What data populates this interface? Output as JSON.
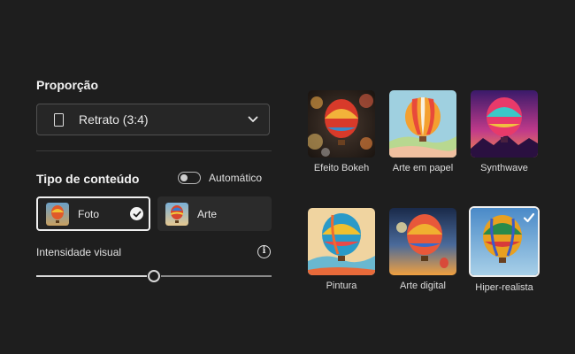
{
  "aspect": {
    "heading": "Proporção",
    "selected": "Retrato (3:4)",
    "icon": "portrait-icon"
  },
  "content_type": {
    "heading": "Tipo de conteúdo",
    "auto_label": "Automático",
    "auto_enabled": false,
    "options": [
      {
        "label": "Foto",
        "selected": true
      },
      {
        "label": "Arte",
        "selected": false
      }
    ]
  },
  "visual_intensity": {
    "label": "Intensidade visual",
    "info_icon": "info-icon",
    "value": 0.5
  },
  "styles": [
    {
      "label": "Efeito Bokeh",
      "selected": false
    },
    {
      "label": "Arte em papel",
      "selected": false
    },
    {
      "label": "Synthwave",
      "selected": false
    },
    {
      "label": "Pintura",
      "selected": false
    },
    {
      "label": "Arte digital",
      "selected": false
    },
    {
      "label": "Hiper-realista",
      "selected": true
    }
  ],
  "colors": {
    "background": "#1e1e1e",
    "panel": "#262626",
    "border_selected": "#f0f0f0"
  }
}
